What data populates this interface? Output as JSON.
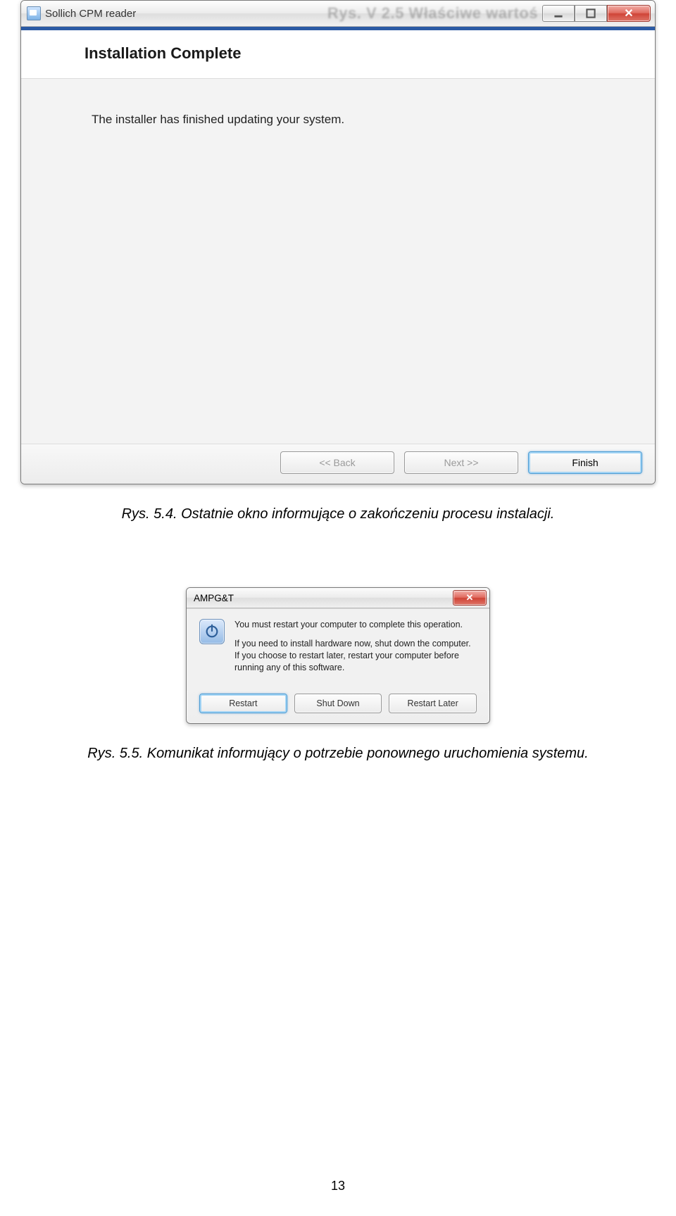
{
  "installer": {
    "title": "Sollich CPM reader",
    "behind_text": "Rys. V 2.5 Właściwe wartoś",
    "heading": "Installation Complete",
    "body": "The installer has finished updating your system.",
    "back": "<< Back",
    "next": "Next >>",
    "finish": "Finish"
  },
  "caption1": "Rys. 5.4. Ostatnie okno informujące o zakończeniu procesu instalacji.",
  "dialog": {
    "title": "AMPG&T",
    "line1": "You must restart your computer to complete this operation.",
    "line2": "If you need to install hardware now, shut down the computer. If you choose to restart later, restart your computer before running any of this software.",
    "restart": "Restart",
    "shutdown": "Shut Down",
    "later": "Restart Later"
  },
  "caption2": "Rys. 5.5. Komunikat informujący o potrzebie ponownego uruchomienia systemu.",
  "page_number": "13"
}
